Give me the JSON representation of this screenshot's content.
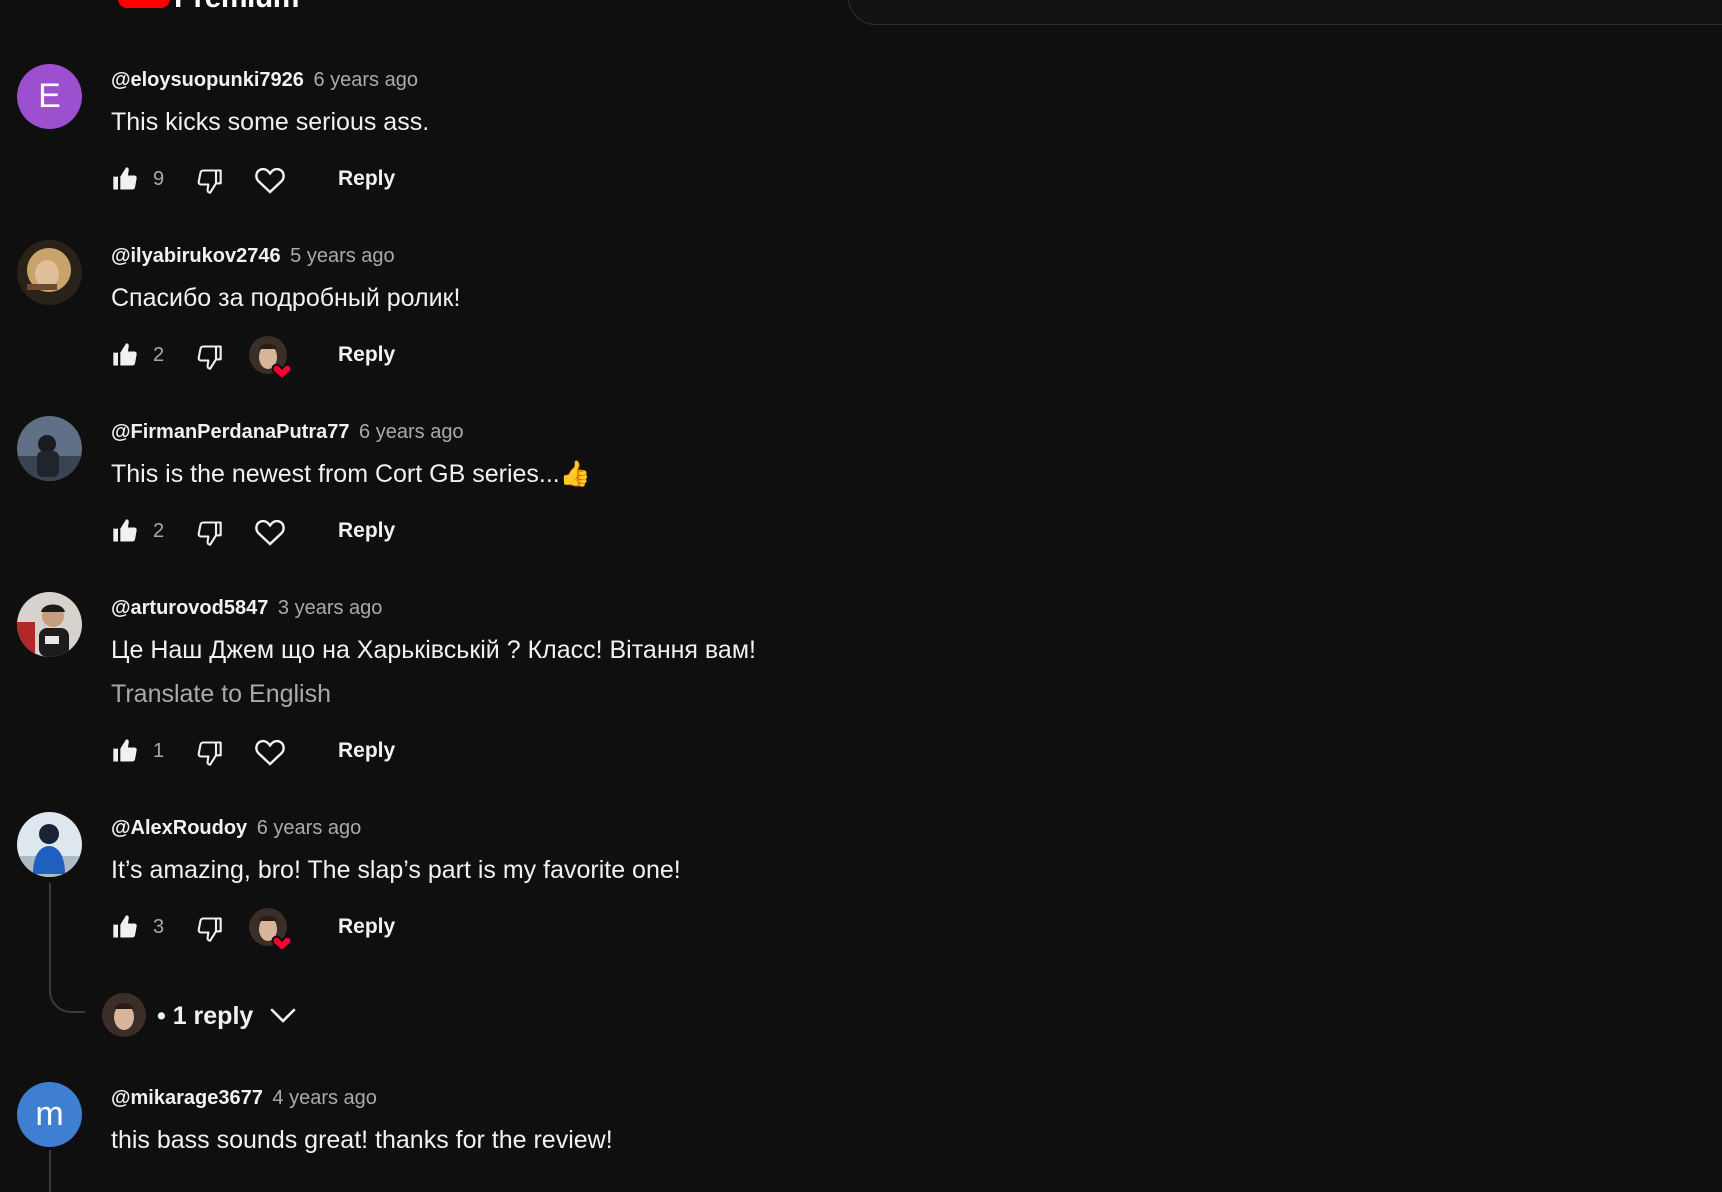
{
  "masthead": {
    "brand_label": "Premium"
  },
  "colors": {
    "background": "#0f0f0f",
    "text_primary": "#f1f1f1",
    "text_secondary": "#aaaaaa",
    "heart_red": "#ff0033",
    "avatar_purple": "#9c4fcf",
    "avatar_blue": "#3e7fd1"
  },
  "comments": [
    {
      "author": "@eloysuopunki7926",
      "time": "6 years ago",
      "text": "This kicks some serious ass.",
      "avatar_letter": "E",
      "likes": "9",
      "hearted_by_creator": false,
      "reply_label": "Reply"
    },
    {
      "author": "@ilyabirukov2746",
      "time": "5 years ago",
      "text": "Спасибо за подробный ролик!",
      "likes": "2",
      "hearted_by_creator": true,
      "reply_label": "Reply"
    },
    {
      "author": "@FirmanPerdanaPutra77",
      "time": "6 years ago",
      "text": "This is the newest from Cort GB series...👍",
      "likes": "2",
      "hearted_by_creator": false,
      "reply_label": "Reply"
    },
    {
      "author": "@arturovod5847",
      "time": "3 years ago",
      "text": "Це Наш Джем що на Харьківській ? Класс! Вітання вам!",
      "translate_label": "Translate to English",
      "likes": "1",
      "hearted_by_creator": false,
      "reply_label": "Reply"
    },
    {
      "author": "@AlexRoudoy",
      "time": "6 years ago",
      "text": "It’s amazing, bro! The slap’s part is my favorite one!",
      "likes": "3",
      "hearted_by_creator": true,
      "reply_label": "Reply",
      "replies_label": "• 1 reply"
    },
    {
      "author": "@mikarage3677",
      "time": "4 years ago",
      "text": "this bass sounds great! thanks for the review!",
      "avatar_letter": "m"
    }
  ]
}
